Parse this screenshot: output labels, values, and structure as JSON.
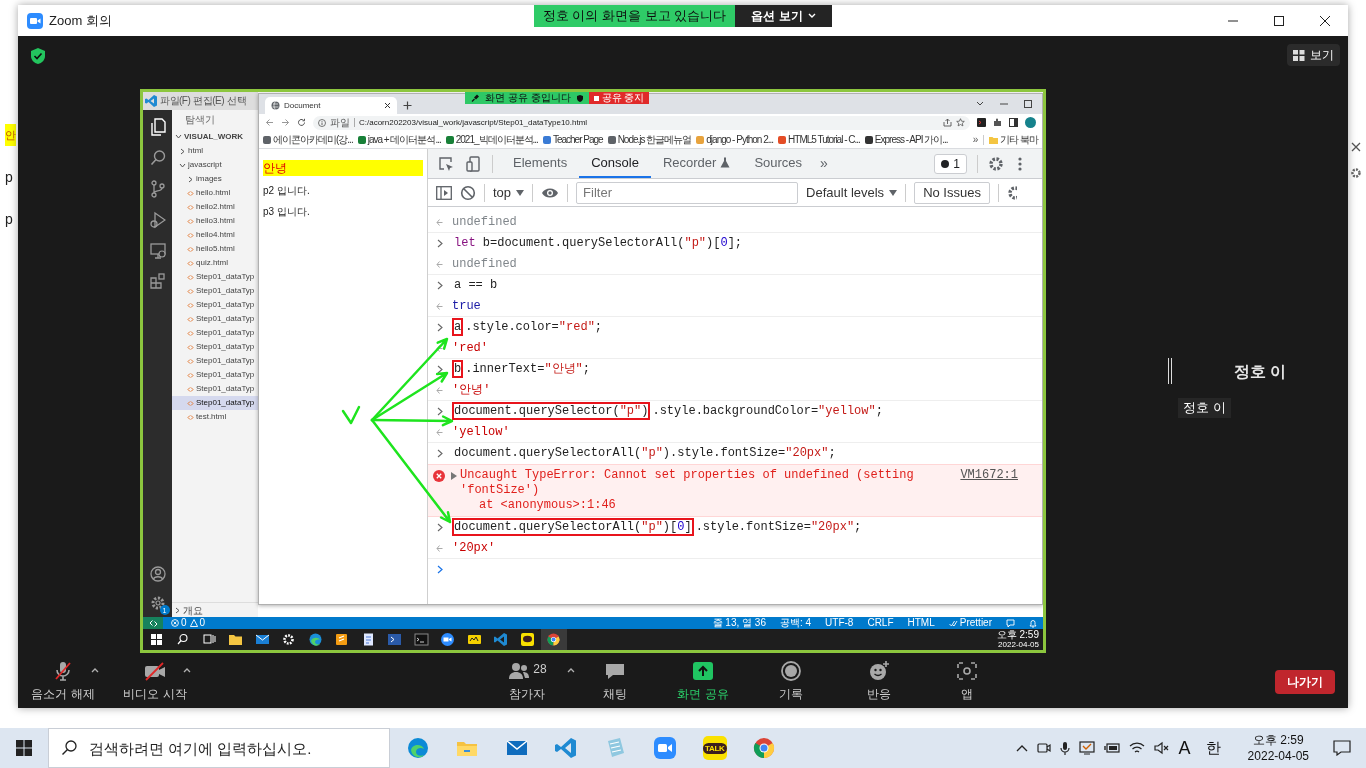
{
  "background_page": {
    "texts": [
      {
        "text": "안",
        "highlighted": true
      },
      {
        "text": "p",
        "highlighted": false
      },
      {
        "text": "p",
        "highlighted": false
      }
    ]
  },
  "zoom": {
    "title": "Zoom 회의",
    "viewing_banner": {
      "text": "정호 이의 화면을 보고 있습니다",
      "options_button": "옵션 보기"
    },
    "view_button": "보기",
    "shared_screen": {
      "vscode": {
        "menu": [
          "파일(F)",
          "편집(E)",
          "선택"
        ],
        "explorer_title": "탐색기",
        "workspace": "VISUAL_WORK",
        "tree": [
          {
            "label": "html",
            "kind": "folder",
            "expanded": false,
            "selected": false
          },
          {
            "label": "javascript",
            "kind": "folder",
            "expanded": true,
            "selected": false,
            "children": [
              {
                "label": "images",
                "kind": "folder",
                "expanded": false,
                "selected": false
              },
              {
                "label": "hello.html",
                "kind": "file",
                "selected": false
              },
              {
                "label": "hello2.html",
                "kind": "file",
                "selected": false
              },
              {
                "label": "hello3.html",
                "kind": "file",
                "selected": false
              },
              {
                "label": "hello4.html",
                "kind": "file",
                "selected": false
              },
              {
                "label": "hello5.html",
                "kind": "file",
                "selected": false
              },
              {
                "label": "quiz.html",
                "kind": "file",
                "selected": false
              },
              {
                "label": "Step01_dataTyp",
                "kind": "file",
                "selected": false
              },
              {
                "label": "Step01_dataTyp",
                "kind": "file",
                "selected": false
              },
              {
                "label": "Step01_dataTyp",
                "kind": "file",
                "selected": false
              },
              {
                "label": "Step01_dataTyp",
                "kind": "file",
                "selected": false
              },
              {
                "label": "Step01_dataTyp",
                "kind": "file",
                "selected": false
              },
              {
                "label": "Step01_dataTyp",
                "kind": "file",
                "selected": false
              },
              {
                "label": "Step01_dataTyp",
                "kind": "file",
                "selected": false
              },
              {
                "label": "Step01_dataTyp",
                "kind": "file",
                "selected": false
              },
              {
                "label": "Step01_dataTyp",
                "kind": "file",
                "selected": false
              },
              {
                "label": "Step01_dataTyp",
                "kind": "file",
                "selected": true
              },
              {
                "label": "test.html",
                "kind": "file",
                "selected": false
              }
            ]
          }
        ],
        "outline": "개요",
        "settings_badge": "1",
        "status_left": {
          "errors": "0",
          "warnings": "0"
        },
        "status_right": [
          "줄 13, 열 36",
          "공백: 4",
          "UTF-8",
          "CRLF",
          "HTML"
        ],
        "formatter": "Prettier"
      },
      "browser": {
        "tab": "Document",
        "address_scheme": "파일",
        "url": "C:/acorn202203/visual_work/javascript/Step01_dataType10.html",
        "bookmarks": [
          "에이콘아카데미(강...",
          "java + 데이터분석...",
          "2021_빅데이터분석...",
          "Teacher Page",
          "Node.js 한글메뉴얼",
          "django - Python 2...",
          "HTML5 Tutorial - C...",
          "Express - API 가이..."
        ],
        "more_bookmarks": "»",
        "other_bookmarks": "기타 북마",
        "page": [
          {
            "text": "안녕",
            "highlighted": true
          },
          {
            "text": "p2 입니다.",
            "highlighted": false
          },
          {
            "text": "p3 입니다.",
            "highlighted": false
          }
        ],
        "devtools": {
          "tabs": [
            {
              "label": "Elements",
              "selected": false,
              "experimental": false
            },
            {
              "label": "Console",
              "selected": true,
              "experimental": false
            },
            {
              "label": "Recorder",
              "selected": false,
              "experimental": true
            },
            {
              "label": "Sources",
              "selected": false,
              "experimental": false
            }
          ],
          "more_tabs": "»",
          "issues_count": "1",
          "context": "top",
          "filter_placeholder": "Filter",
          "levels": "Default levels",
          "issues": "No Issues",
          "console": [
            {
              "kind": "undefined",
              "text": "undefined"
            },
            {
              "kind": "input",
              "segments": [
                {
                  "boxed": false,
                  "tokens": [
                    {
                      "kind": "keyword",
                      "text": "let"
                    },
                    {
                      "kind": "plain",
                      "text": " b=document.querySelectorAll("
                    },
                    {
                      "kind": "string",
                      "text": "\"p\""
                    },
                    {
                      "kind": "plain",
                      "text": ")["
                    },
                    {
                      "kind": "number",
                      "text": "0"
                    },
                    {
                      "kind": "plain",
                      "text": "];"
                    }
                  ]
                }
              ]
            },
            {
              "kind": "undefined",
              "text": "undefined"
            },
            {
              "kind": "input",
              "segments": [
                {
                  "boxed": false,
                  "tokens": [
                    {
                      "kind": "plain",
                      "text": "a == b"
                    }
                  ]
                }
              ]
            },
            {
              "kind": "boolean",
              "text": "true"
            },
            {
              "kind": "input",
              "segments": [
                {
                  "boxed": true,
                  "tokens": [
                    {
                      "kind": "plain",
                      "text": "a"
                    }
                  ]
                },
                {
                  "boxed": false,
                  "tokens": [
                    {
                      "kind": "plain",
                      "text": ".style.color="
                    },
                    {
                      "kind": "string",
                      "text": "\"red\""
                    },
                    {
                      "kind": "plain",
                      "text": ";"
                    }
                  ]
                }
              ]
            },
            {
              "kind": "string",
              "text": "'red'"
            },
            {
              "kind": "input",
              "segments": [
                {
                  "boxed": true,
                  "tokens": [
                    {
                      "kind": "plain",
                      "text": "b"
                    }
                  ]
                },
                {
                  "boxed": false,
                  "tokens": [
                    {
                      "kind": "plain",
                      "text": ".innerText="
                    },
                    {
                      "kind": "string",
                      "text": "\"안녕\""
                    },
                    {
                      "kind": "plain",
                      "text": ";"
                    }
                  ]
                }
              ]
            },
            {
              "kind": "string",
              "text": "'안녕'"
            },
            {
              "kind": "input",
              "segments": [
                {
                  "boxed": true,
                  "tokens": [
                    {
                      "kind": "plain",
                      "text": "document.querySelector("
                    },
                    {
                      "kind": "string",
                      "text": "\"p\""
                    },
                    {
                      "kind": "plain",
                      "text": ")"
                    }
                  ]
                },
                {
                  "boxed": false,
                  "tokens": [
                    {
                      "kind": "plain",
                      "text": ".style.backgroundColor="
                    },
                    {
                      "kind": "string",
                      "text": "\"yellow\""
                    },
                    {
                      "kind": "plain",
                      "text": ";"
                    }
                  ]
                }
              ]
            },
            {
              "kind": "string",
              "text": "'yellow'"
            },
            {
              "kind": "input",
              "segments": [
                {
                  "boxed": false,
                  "tokens": [
                    {
                      "kind": "plain",
                      "text": "document.querySelectorAll("
                    },
                    {
                      "kind": "string",
                      "text": "\"p\""
                    },
                    {
                      "kind": "plain",
                      "text": ").style.fontSize="
                    },
                    {
                      "kind": "string",
                      "text": "\"20px\""
                    },
                    {
                      "kind": "plain",
                      "text": ";"
                    }
                  ]
                }
              ]
            },
            {
              "kind": "error",
              "message": "Uncaught TypeError: Cannot set properties of undefined (setting 'fontSize')",
              "stack": "at <anonymous>:1:46",
              "source": "VM1672:1"
            },
            {
              "kind": "input",
              "segments": [
                {
                  "boxed": true,
                  "tokens": [
                    {
                      "kind": "plain",
                      "text": "document.querySelectorAll("
                    },
                    {
                      "kind": "string",
                      "text": "\"p\""
                    },
                    {
                      "kind": "plain",
                      "text": ")["
                    },
                    {
                      "kind": "number",
                      "text": "0"
                    },
                    {
                      "kind": "plain",
                      "text": "]"
                    }
                  ]
                },
                {
                  "boxed": false,
                  "tokens": [
                    {
                      "kind": "plain",
                      "text": ".style.fontSize="
                    },
                    {
                      "kind": "string",
                      "text": "\"20px\""
                    },
                    {
                      "kind": "plain",
                      "text": ";"
                    }
                  ]
                }
              ]
            },
            {
              "kind": "string",
              "text": "'20px'"
            },
            {
              "kind": "prompt"
            }
          ]
        }
      },
      "sharing_bar": {
        "text": "화면 공유 중입니다",
        "stop_button": "공유 중지"
      },
      "taskbar": {
        "time": "오후 2:59",
        "date": "2022-04-05"
      }
    },
    "participant": {
      "name": "정호 이",
      "label": "정호 이"
    },
    "toolbar": [
      {
        "kind": "mic",
        "label": "음소거 해제",
        "caret": true
      },
      {
        "kind": "video",
        "label": "비디오 시작",
        "caret": true
      },
      {
        "kind": "participants",
        "label": "참가자",
        "count": "28",
        "caret": true
      },
      {
        "kind": "chat",
        "label": "채팅",
        "caret": false
      },
      {
        "kind": "share",
        "label": "화면 공유",
        "caret": false
      },
      {
        "kind": "record",
        "label": "기록",
        "caret": false
      },
      {
        "kind": "reactions",
        "label": "반응",
        "caret": false
      },
      {
        "kind": "apps",
        "label": "앱",
        "caret": false
      }
    ],
    "leave_button": "나가기"
  },
  "taskbar": {
    "search_placeholder": "검색하려면 여기에 입력하십시오.",
    "chat_app_label": "TALK",
    "input_mode": "A",
    "language": "한",
    "time": "오후 2:59",
    "date": "2022-04-05"
  }
}
